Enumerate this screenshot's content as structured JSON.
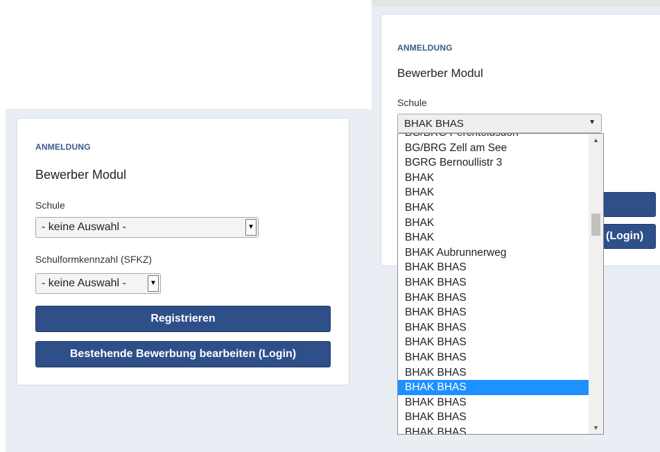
{
  "left_panel": {
    "section_label": "ANMELDUNG",
    "title": "Bewerber Modul",
    "school_label": "Schule",
    "school_value": "- keine Auswahl -",
    "sfkz_label": "Schulformkennzahl (SFKZ)",
    "sfkz_value": "- keine Auswahl -",
    "register_button": "Registrieren",
    "login_button": "Bestehende Bewerbung bearbeiten (Login)"
  },
  "right_panel": {
    "section_label": "ANMELDUNG",
    "title": "Bewerber Modul",
    "school_label": "Schule",
    "school_value": "BHAK BHAS",
    "login_button_partial": "(Login)",
    "dropdown_options": [
      "BG/BRG Perchtoldsdorf",
      "BG/BRG Zell am See",
      "BGRG Bernoullistr 3",
      "BHAK",
      "BHAK",
      "BHAK",
      "BHAK",
      "BHAK",
      "BHAK Aubrunnerweg",
      "BHAK BHAS",
      "BHAK BHAS",
      "BHAK BHAS",
      "BHAK BHAS",
      "BHAK BHAS",
      "BHAK BHAS",
      "BHAK BHAS",
      "BHAK BHAS",
      "BHAK BHAS",
      "BHAK BHAS",
      "BHAK BHAS",
      "BHAK BHAS",
      "BHAK BHAS"
    ],
    "selected_index": 17
  },
  "colors": {
    "accent": "#2f4f89",
    "label_blue": "#3a5a8c",
    "selection": "#1e90ff",
    "background": "#e9eef4"
  }
}
